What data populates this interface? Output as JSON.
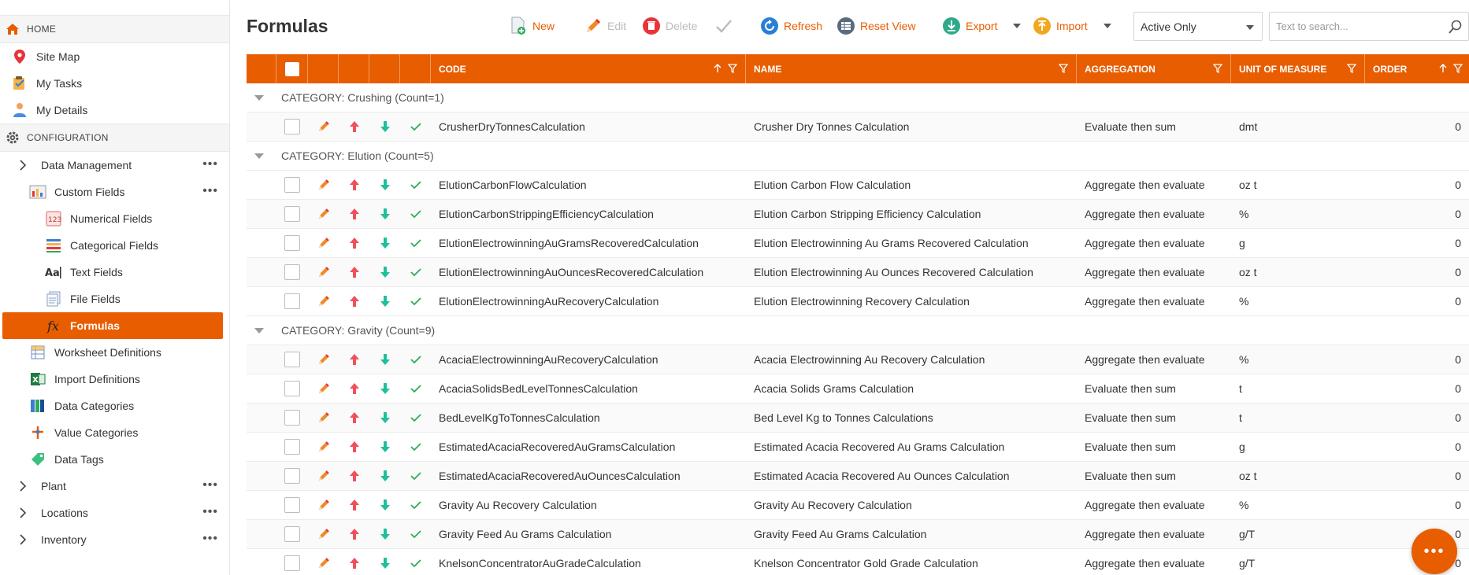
{
  "sidebar": {
    "home": "HOME",
    "top_items": [
      {
        "label": "Site Map",
        "icon": "map-pin-icon"
      },
      {
        "label": "My Tasks",
        "icon": "tasks-icon"
      },
      {
        "label": "My Details",
        "icon": "user-icon"
      }
    ],
    "config": "CONFIGURATION",
    "data_management": "Data Management",
    "custom_fields": "Custom Fields",
    "custom_children": [
      {
        "label": "Numerical Fields",
        "icon": "numerical-fields-icon"
      },
      {
        "label": "Categorical Fields",
        "icon": "categorical-fields-icon"
      },
      {
        "label": "Text Fields",
        "icon": "text-fields-icon"
      },
      {
        "label": "File Fields",
        "icon": "file-fields-icon"
      },
      {
        "label": "Formulas",
        "icon": "formula-icon"
      }
    ],
    "config_items": [
      {
        "label": "Worksheet Definitions",
        "icon": "worksheet-icon"
      },
      {
        "label": "Import Definitions",
        "icon": "excel-icon"
      },
      {
        "label": "Data Categories",
        "icon": "data-categories-icon"
      },
      {
        "label": "Value Categories",
        "icon": "value-categories-icon"
      },
      {
        "label": "Data Tags",
        "icon": "tag-icon"
      }
    ],
    "groups": [
      {
        "label": "Plant"
      },
      {
        "label": "Locations"
      },
      {
        "label": "Inventory"
      }
    ],
    "dots": "•••"
  },
  "toolbar": {
    "title": "Formulas",
    "new": "New",
    "edit": "Edit",
    "delete": "Delete",
    "refresh": "Refresh",
    "reset_view": "Reset View",
    "export": "Export",
    "import": "Import",
    "filter_value": "Active Only",
    "search_placeholder": "Text to search..."
  },
  "grid": {
    "columns": {
      "code": "CODE",
      "name": "NAME",
      "aggregation": "AGGREGATION",
      "uom": "UNIT OF MEASURE",
      "order": "ORDER"
    },
    "groups": [
      {
        "header": "CATEGORY: Crushing (Count=1)",
        "rows": [
          {
            "code": "CrusherDryTonnesCalculation",
            "name": "Crusher Dry Tonnes Calculation",
            "aggregation": "Evaluate then sum",
            "uom": "dmt",
            "order": "0"
          }
        ]
      },
      {
        "header": "CATEGORY: Elution (Count=5)",
        "rows": [
          {
            "code": "ElutionCarbonFlowCalculation",
            "name": "Elution Carbon Flow Calculation",
            "aggregation": "Aggregate then evaluate",
            "uom": "oz t",
            "order": "0"
          },
          {
            "code": "ElutionCarbonStrippingEfficiencyCalculation",
            "name": "Elution Carbon Stripping Efficiency Calculation",
            "aggregation": "Aggregate then evaluate",
            "uom": "%",
            "order": "0"
          },
          {
            "code": "ElutionElectrowinningAuGramsRecoveredCalculation",
            "name": "Elution Electrowinning Au Grams Recovered Calculation",
            "aggregation": "Aggregate then evaluate",
            "uom": "g",
            "order": "0"
          },
          {
            "code": "ElutionElectrowinningAuOuncesRecoveredCalculation",
            "name": "Elution Electrowinning Au Ounces Recovered Calculation",
            "aggregation": "Aggregate then evaluate",
            "uom": "oz t",
            "order": "0"
          },
          {
            "code": "ElutionElectrowinningAuRecoveryCalculation",
            "name": "Elution Electrowinning Recovery Calculation",
            "aggregation": "Aggregate then evaluate",
            "uom": "%",
            "order": "0"
          }
        ]
      },
      {
        "header": "CATEGORY: Gravity (Count=9)",
        "rows": [
          {
            "code": "AcaciaElectrowinningAuRecoveryCalculation",
            "name": "Acacia Electrowinning Au Recovery Calculation",
            "aggregation": "Aggregate then evaluate",
            "uom": "%",
            "order": "0"
          },
          {
            "code": "AcaciaSolidsBedLevelTonnesCalculation",
            "name": "Acacia Solids Grams Calculation",
            "aggregation": "Evaluate then sum",
            "uom": "t",
            "order": "0"
          },
          {
            "code": "BedLevelKgToTonnesCalculation",
            "name": "Bed Level Kg to Tonnes Calculations",
            "aggregation": "Evaluate then sum",
            "uom": "t",
            "order": "0"
          },
          {
            "code": "EstimatedAcaciaRecoveredAuGramsCalculation",
            "name": "Estimated Acacia Recovered Au Grams Calculation",
            "aggregation": "Evaluate then sum",
            "uom": "g",
            "order": "0"
          },
          {
            "code": "EstimatedAcaciaRecoveredAuOuncesCalculation",
            "name": "Estimated Acacia Recovered Au Ounces Calculation",
            "aggregation": "Evaluate then sum",
            "uom": "oz t",
            "order": "0"
          },
          {
            "code": "Gravity Au Recovery Calculation",
            "name": "Gravity Au Recovery Calculation",
            "aggregation": "Aggregate then evaluate",
            "uom": "%",
            "order": "0"
          },
          {
            "code": "Gravity Feed Au Grams Calculation",
            "name": "Gravity Feed Au Grams Calculation",
            "aggregation": "Aggregate then evaluate",
            "uom": "g/T",
            "order": "0"
          },
          {
            "code": "KnelsonConcentratorAuGradeCalculation",
            "name": "Knelson Concentrator Gold Grade Calculation",
            "aggregation": "Aggregate then evaluate",
            "uom": "g/T",
            "order": "0"
          }
        ]
      }
    ]
  },
  "fab": "•••",
  "colors": {
    "accent": "#e85d00",
    "up": "#f0505a",
    "down": "#1fbf9c",
    "check": "#2eaa5c"
  }
}
